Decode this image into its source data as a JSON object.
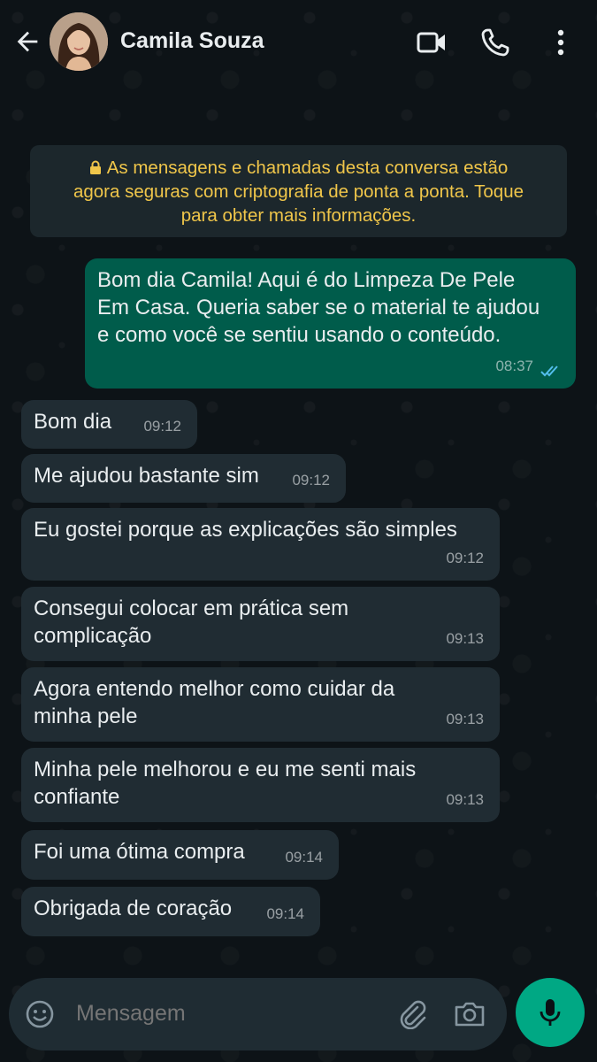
{
  "header": {
    "contact_name": "Camila Souza",
    "icons": [
      "back-arrow-icon",
      "avatar",
      "video-call-icon",
      "phone-call-icon",
      "more-options-icon"
    ]
  },
  "encryption_notice": {
    "text": "As mensagens e chamadas desta conversa estão agora seguras com criptografia de ponta a ponta. Toque para obter mais informações.",
    "line1": "As mensagens e chamadas desta conversa estão",
    "line2": "agora seguras com criptografia de ponta a ponta. Toque",
    "line3": "para obter mais informações.",
    "color": "#f0c64a"
  },
  "messages": [
    {
      "direction": "outgoing",
      "lines": [
        "Bom dia Camila! Aqui é do Limpeza De Pele",
        "Em Casa. Queria saber se o material te ajudou",
        "e como você se sentiu usando o conteúdo."
      ],
      "time": "08:37",
      "status": "read"
    },
    {
      "direction": "incoming",
      "lines": [
        "Bom dia"
      ],
      "time": "09:12"
    },
    {
      "direction": "incoming",
      "lines": [
        "Me ajudou bastante sim"
      ],
      "time": "09:12"
    },
    {
      "direction": "incoming",
      "lines": [
        "Eu gostei porque as explicações são simples"
      ],
      "time": "09:12"
    },
    {
      "direction": "incoming",
      "lines": [
        "Consegui colocar em prática sem",
        "complicação"
      ],
      "time": "09:13"
    },
    {
      "direction": "incoming",
      "lines": [
        "Agora entendo melhor como cuidar da",
        "minha pele"
      ],
      "time": "09:13"
    },
    {
      "direction": "incoming",
      "lines": [
        "Minha pele melhorou e eu me senti mais",
        "confiante"
      ],
      "time": "09:13"
    },
    {
      "direction": "incoming",
      "lines": [
        "Foi uma ótima compra"
      ],
      "time": "09:14"
    },
    {
      "direction": "incoming",
      "lines": [
        "Obrigada de coração"
      ],
      "time": "09:14"
    }
  ],
  "composer": {
    "placeholder": "Mensagem",
    "icons": [
      "emoji-icon",
      "attach-icon",
      "camera-icon",
      "mic-icon"
    ]
  },
  "colors": {
    "incoming_bubble": "#202c33",
    "outgoing_bubble": "#005c4b",
    "accent": "#00a884",
    "read_ticks": "#53bdeb"
  }
}
